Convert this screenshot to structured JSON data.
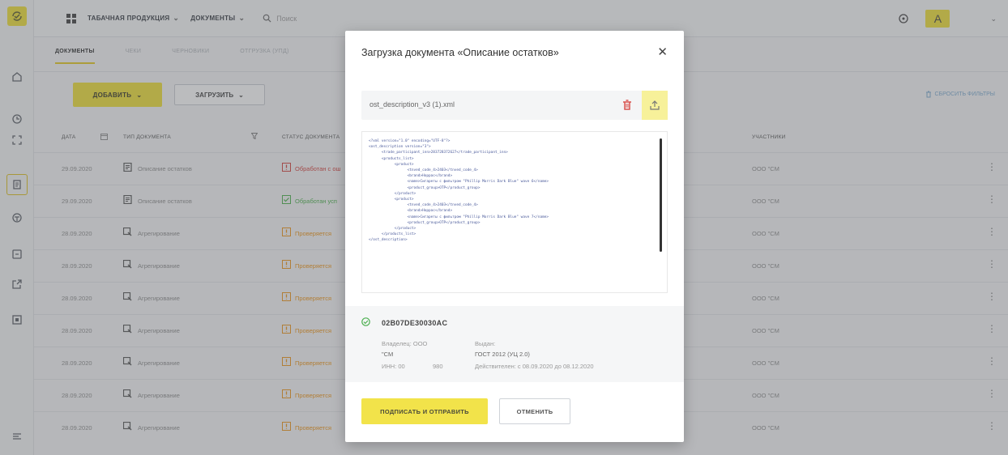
{
  "topbar": {
    "menu_products": "ТАБАЧНАЯ ПРОДУКЦИЯ",
    "menu_documents": "ДОКУМЕНТЫ",
    "search_placeholder": "Поиск",
    "avatar_letter": "А"
  },
  "tabs": [
    {
      "label": "ДОКУМЕНТЫ",
      "active": true
    },
    {
      "label": "ЧЕКИ",
      "active": false
    },
    {
      "label": "ЧЕРНОВИКИ",
      "active": false
    },
    {
      "label": "ОТГРУЗКА (УПД)",
      "active": false
    }
  ],
  "actions": {
    "add_label": "ДОБАВИТЬ",
    "load_label": "ЗАГРУЗИТЬ",
    "reset_filters": "СБРОСИТЬ ФИЛЬТРЫ"
  },
  "table": {
    "headers": {
      "date": "ДАТА",
      "doc_type": "ТИП ДОКУМЕНТА",
      "status": "СТАТУС ДОКУМЕНТА",
      "participants": "УЧАСТНИКИ"
    },
    "rows": [
      {
        "date": "29.09.2020",
        "type": "Описание остатков",
        "status": "Обработан с ош",
        "participant": "ООО \"СМ"
      },
      {
        "date": "29.09.2020",
        "type": "Описание остатков",
        "status": "Обработан усп",
        "participant": "ООО \"СМ"
      },
      {
        "date": "28.09.2020",
        "type": "Агрегирование",
        "status": "Проверяется",
        "participant": "ООО \"СМ"
      },
      {
        "date": "28.09.2020",
        "type": "Агрегирование",
        "status": "Проверяется",
        "participant": "ООО \"СМ"
      },
      {
        "date": "28.09.2020",
        "type": "Агрегирование",
        "status": "Проверяется",
        "participant": "ООО \"СМ"
      },
      {
        "date": "28.09.2020",
        "type": "Агрегирование",
        "status": "Проверяется",
        "participant": "ООО \"СМ"
      },
      {
        "date": "28.09.2020",
        "type": "Агрегирование",
        "status": "Проверяется",
        "participant": "ООО \"СМ"
      },
      {
        "date": "28.09.2020",
        "type": "Агрегирование",
        "status": "Проверяется",
        "participant": "ООО \"СМ"
      },
      {
        "date": "28.09.2020",
        "type": "Агрегирование",
        "status": "Проверяется",
        "participant": "ООО \"СМ"
      }
    ]
  },
  "modal": {
    "title": "Загрузка документа «Описание остатков»",
    "file_name": "ost_description_v3 (1).xml",
    "xml_lines": [
      "<?xml version=\"1.0\" encoding=\"UTF-8\"?>",
      "<ost_description version=\"3\">",
      "      <trade_participant_inn>283728372627</trade_participant_inn>",
      "      <products_list>",
      "            <product>",
      "                  <tnved_code_4>2403</tnved_code_4>",
      "                  <brand>Норрас</brand>",
      "                  <name>Сигареты с фильтром \"Phillip Morris Dark Blue\" wave 6</name>",
      "                  <product_group>ОТР</product_group>",
      "            </product>",
      "            <product>",
      "                  <tnved_code_4>2403</tnved_code_4>",
      "                  <brand>Норрас</brand>",
      "                  <name>Сигареты с фильтром \"Phillip Morris Dark Blue\" wave 7</name>",
      "                  <product_group>ОТР</product_group>",
      "            </product>",
      "      </products_list>",
      "</ost_description>"
    ],
    "certificate": {
      "id": "02B07DE30030AC",
      "owner_label": "Владелец: ООО",
      "owner_value": "\"СМ",
      "inn_label": "ИНН: 00",
      "inn_value": "980",
      "issuer_label": "Выдан:",
      "issuer_value": "ГОСТ 2012 (УЦ 2.0)",
      "validity": "Действителен: с 08.09.2020 до 08.12.2020"
    },
    "sign_label": "ПОДПИСАТЬ И ОТПРАВИТЬ",
    "cancel_label": "ОТМЕНИТЬ"
  },
  "colors": {
    "accent": "#f2e34a",
    "status_error": "#d9534f",
    "status_success": "#5cb85c",
    "status_pending": "#f0a030",
    "cert_valid": "#4caf50"
  }
}
